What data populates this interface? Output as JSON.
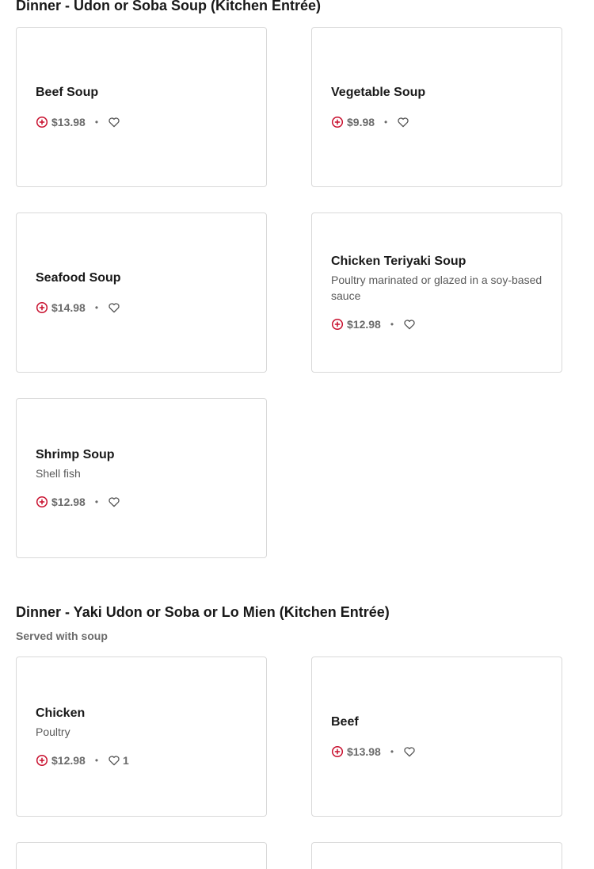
{
  "sections": [
    {
      "title": "Dinner - Udon or Soba Soup (Kitchen Entrée)",
      "subtitle": "",
      "items": [
        {
          "name": "Beef Soup",
          "description": "",
          "price": "$13.98",
          "likes": ""
        },
        {
          "name": "Vegetable Soup",
          "description": "",
          "price": "$9.98",
          "likes": ""
        },
        {
          "name": "Seafood Soup",
          "description": "",
          "price": "$14.98",
          "likes": ""
        },
        {
          "name": "Chicken Teriyaki Soup",
          "description": "Poultry marinated or glazed in a soy-based sauce",
          "price": "$12.98",
          "likes": ""
        },
        {
          "name": "Shrimp Soup",
          "description": "Shell fish",
          "price": "$12.98",
          "likes": ""
        }
      ]
    },
    {
      "title": "Dinner - Yaki Udon or Soba or Lo Mien (Kitchen Entrée)",
      "subtitle": "Served with soup",
      "items": [
        {
          "name": "Chicken",
          "description": "Poultry",
          "price": "$12.98",
          "likes": "1"
        },
        {
          "name": "Beef",
          "description": "",
          "price": "$13.98",
          "likes": ""
        },
        {
          "name": "",
          "description": "",
          "price": "",
          "likes": ""
        },
        {
          "name": "",
          "description": "",
          "price": "",
          "likes": ""
        }
      ]
    }
  ],
  "icons": {
    "add": "plus-circle-icon",
    "like": "heart-icon"
  },
  "colors": {
    "accent": "#c8102e",
    "border": "#d9d9d9",
    "muted": "#6b6b6b"
  }
}
